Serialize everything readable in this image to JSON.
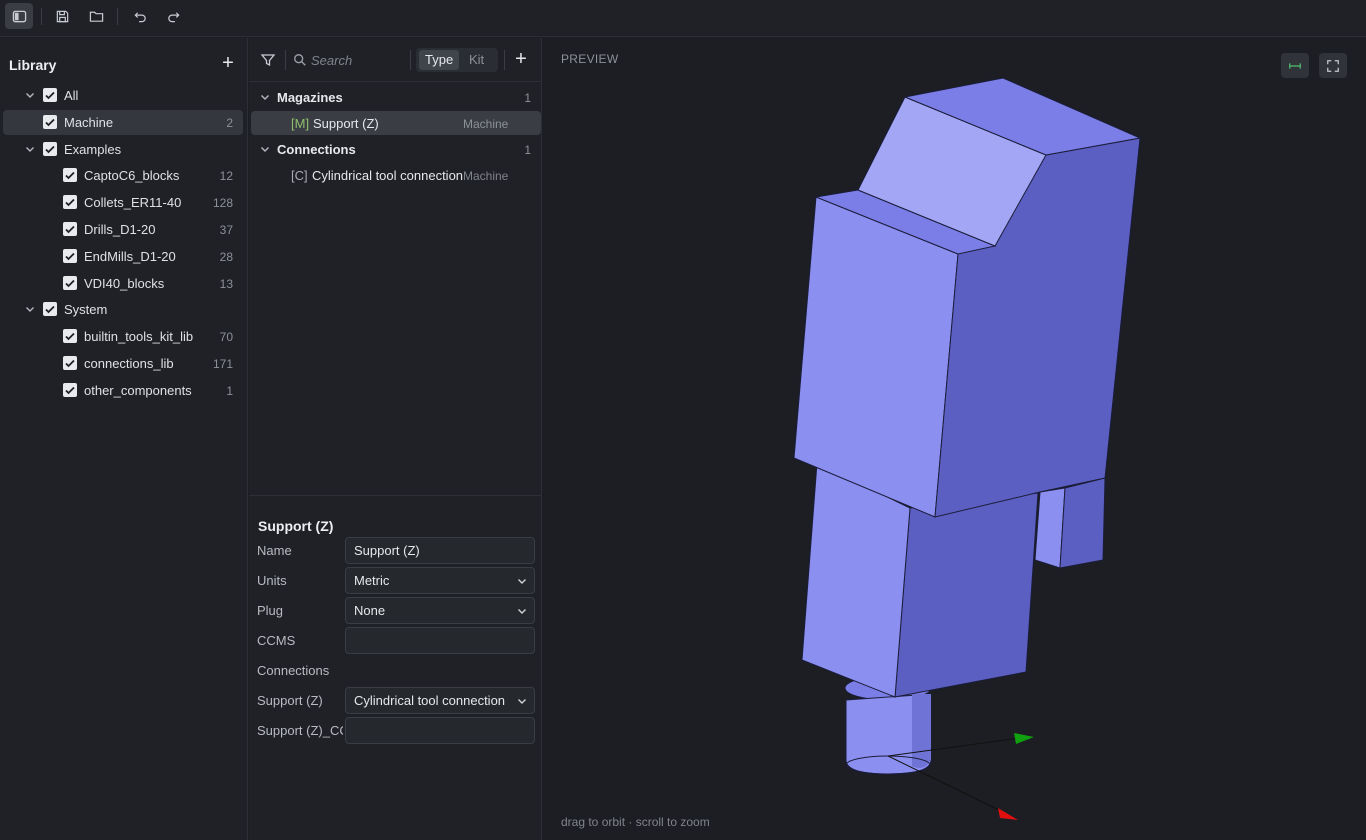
{
  "toolbar": {
    "buttons": [
      {
        "icon": "sidebar-toggle-icon"
      },
      {
        "icon": "save-icon"
      },
      {
        "icon": "folder-open-icon"
      },
      {
        "icon": "undo-icon"
      },
      {
        "icon": "redo-icon"
      }
    ]
  },
  "library": {
    "title": "Library",
    "add_label": "+",
    "items": [
      {
        "label": "All",
        "count": "",
        "checked": true,
        "expanded": true
      },
      {
        "label": "Machine",
        "count": "2",
        "checked": true,
        "selected": true
      },
      {
        "label": "Examples",
        "count": "",
        "checked": true,
        "expanded": true
      },
      {
        "label": "CaptoC6_blocks",
        "count": "12",
        "checked": true
      },
      {
        "label": "Collets_ER11-40",
        "count": "128",
        "checked": true
      },
      {
        "label": "Drills_D1-20",
        "count": "37",
        "checked": true
      },
      {
        "label": "EndMills_D1-20",
        "count": "28",
        "checked": true
      },
      {
        "label": "VDI40_blocks",
        "count": "13",
        "checked": true
      },
      {
        "label": "System",
        "count": "",
        "checked": true,
        "expanded": true
      },
      {
        "label": "builtin_tools_kit_lib",
        "count": "70",
        "checked": true
      },
      {
        "label": "connections_lib",
        "count": "171",
        "checked": true
      },
      {
        "label": "other_components",
        "count": "1",
        "checked": true
      }
    ]
  },
  "list": {
    "search_placeholder": "Search",
    "segment": {
      "type_label": "Type",
      "kit_label": "Kit",
      "active": "Type"
    },
    "add_label": "+",
    "groups": [
      {
        "label": "Magazines",
        "count": "1",
        "items": [
          {
            "tag": "[M]",
            "name": "Support (Z)",
            "type": "Machine",
            "selected": true
          }
        ]
      },
      {
        "label": "Connections",
        "count": "1",
        "items": [
          {
            "tag": "[C]",
            "name": "Cylindrical tool connection",
            "type": "Machine",
            "selected": false
          }
        ]
      }
    ]
  },
  "properties": {
    "title": "Support (Z)",
    "name_label": "Name",
    "name_value": "Support (Z)",
    "units_label": "Units",
    "units_value": "Metric",
    "plug_label": "Plug",
    "plug_value": "None",
    "ccms_label": "CCMS",
    "ccms_value": "",
    "connections_label": "Connections",
    "support_label": "Support (Z)",
    "support_value": "Cylindrical tool connection",
    "support_cc_label": "Support (Z)_CCMS",
    "support_cc_value": ""
  },
  "preview": {
    "title": "PREVIEW",
    "hint": "drag to orbit · scroll to zoom",
    "buttons": [
      {
        "icon": "measure-icon"
      },
      {
        "icon": "fullscreen-icon"
      }
    ]
  },
  "colors": {
    "model_top": "#a3a6f5",
    "model_front": "#8b8ff0",
    "model_side": "#5c5fc2",
    "axis_x": "#e01010",
    "axis_y": "#10a010",
    "tag_m": "#8fbf6a",
    "tag_c": "#a8abb2"
  }
}
